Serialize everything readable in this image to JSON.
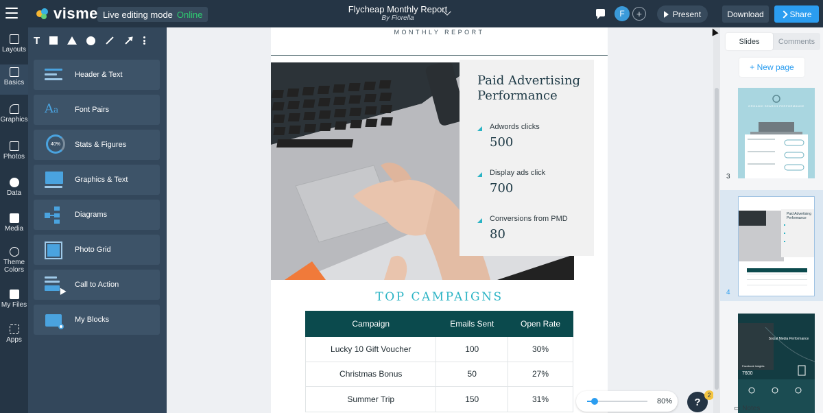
{
  "topbar": {
    "logo_text": "visme",
    "mode_label": "Live editing mode",
    "mode_status": "Online",
    "doc_title": "Flycheap Monthly Report",
    "doc_author": "By Fiorella",
    "avatar_initial": "F",
    "present_label": "Present",
    "download_label": "Download",
    "share_label": "Share"
  },
  "rail": {
    "items": [
      {
        "label": "Layouts",
        "icon": "layouts-icon"
      },
      {
        "label": "Basics",
        "icon": "basics-icon"
      },
      {
        "label": "Graphics",
        "icon": "graphics-icon"
      },
      {
        "label": "Photos",
        "icon": "photos-icon"
      },
      {
        "label": "Data",
        "icon": "data-icon"
      },
      {
        "label": "Media",
        "icon": "media-icon"
      },
      {
        "label": "Theme Colors",
        "icon": "theme-colors-icon"
      },
      {
        "label": "My Files",
        "icon": "my-files-icon"
      },
      {
        "label": "Apps",
        "icon": "apps-icon"
      }
    ]
  },
  "panel": {
    "shapes": [
      "T",
      "rectangle",
      "triangle",
      "circle",
      "line",
      "arrow",
      "more"
    ],
    "blocks": [
      {
        "label": "Header & Text"
      },
      {
        "label": "Font Pairs"
      },
      {
        "label": "Stats & Figures"
      },
      {
        "label": "Graphics & Text"
      },
      {
        "label": "Diagrams"
      },
      {
        "label": "Photo Grid"
      },
      {
        "label": "Call to Action"
      },
      {
        "label": "My Blocks"
      }
    ],
    "stats_badge": "40%"
  },
  "slide": {
    "monthly_report": "MONTHLY REPORT",
    "card_title": "Paid Advertising Performance",
    "stats": [
      {
        "label": "Adwords clicks",
        "value": "500"
      },
      {
        "label": "Display ads click",
        "value": "700"
      },
      {
        "label": "Conversions from PMD",
        "value": "80"
      }
    ],
    "campaigns_title": "TOP CAMPAIGNS",
    "table": {
      "headers": [
        "Campaign",
        "Emails Sent",
        "Open Rate"
      ],
      "rows": [
        [
          "Lucky 10 Gift Voucher",
          "100",
          "30%"
        ],
        [
          "Christmas Bonus",
          "50",
          "27%"
        ],
        [
          "Summer Trip",
          "150",
          "31%"
        ]
      ]
    }
  },
  "zoom": {
    "level": "80%",
    "fraction": 0.12
  },
  "help": {
    "label": "?",
    "badge": "2"
  },
  "rpanel": {
    "tabs": [
      "Slides",
      "Comments"
    ],
    "active_tab": "Slides",
    "new_page": "+ New page",
    "thumbnails": [
      {
        "number": "3",
        "title": "ORGANIC SEARCH PERFORMANCE"
      },
      {
        "number": "4",
        "title": "Paid Advertising Performance"
      },
      {
        "number": "",
        "title": "Social Media Performance",
        "subtitle": "Facebook Insights",
        "value": "7600"
      }
    ],
    "notes_label": "Notes"
  }
}
